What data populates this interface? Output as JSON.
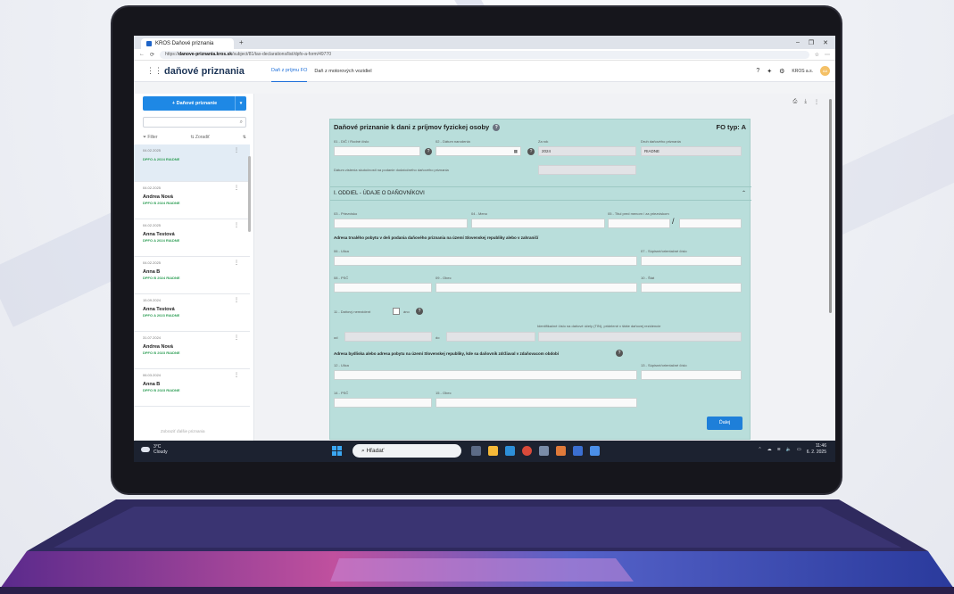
{
  "browser": {
    "tab_title": "KROS Daňové priznania",
    "url_prefix": "https://",
    "url_host": "danove-priznania.kros.sk",
    "url_path": "/subject/81/tax-declarations/list/dpfo-a-form/49770"
  },
  "app": {
    "brand": "daňové priznania",
    "nav_tabs": [
      "Daň z príjmu FO",
      "Daň z motorových vozidiel"
    ],
    "org": "KROS a.s.",
    "avatar": "AA"
  },
  "sidebar": {
    "new_button": "+ Daňové priznanie",
    "filter": "Filter",
    "sort": "Zoradiť",
    "items": [
      {
        "date": "04.02.2025",
        "name": "",
        "status": "DPFO A 2024 RIADNE"
      },
      {
        "date": "04.02.2025",
        "name": "Andrea Nová",
        "status": "DPFO B 2024 RIADNE"
      },
      {
        "date": "04.02.2025",
        "name": "Anna Testová",
        "status": "DPFO A 2024 RIADNE"
      },
      {
        "date": "04.02.2025",
        "name": "Anna B",
        "status": "DPFO B 2024 RIADNE"
      },
      {
        "date": "15.09.2024",
        "name": "Anna Testová",
        "status": "DPFO A 2023 RIADNE"
      },
      {
        "date": "31.07.2024",
        "name": "Andrea Nová",
        "status": "DPFO B 2023 RIADNE"
      },
      {
        "date": "06.03.2024",
        "name": "Anna B",
        "status": "DPFO B 2023 RIADNE"
      }
    ],
    "footer": "Zobraziť ďalšie priznania"
  },
  "form": {
    "title": "Daňové priznanie k dani z príjmov fyzickej osoby",
    "type": "FO typ: A",
    "labels": {
      "dic": "01 - DIČ / Rodné číslo",
      "birth": "02 - Dátum narodenia",
      "year": "Za rok",
      "kind": "Druh daňového priznania",
      "date_note": "Dátum zistenia skutočnosti na podanie dodatočného daňového priznania",
      "surname": "03 - Priezvisko",
      "name": "04 - Meno",
      "titles": "05 - Titul pred menom / za priezviskom",
      "address_head": "Adresa trvalého pobytu v deň podania daňového priznania na území Slovenskej republiky alebo v zahraničí",
      "street": "06 - Ulica",
      "number": "07 - Súpisné/orientačné číslo",
      "zip": "08 - PSČ",
      "city": "09 - Obec",
      "state": "10 - Štát",
      "nonresident": "11 - Daňový nerezident",
      "yes": "áno",
      "tin": "Identifikačné číslo na daňové účely (TIN), pridelené v štáte daňovej rezidencie",
      "from": "od",
      "to": "do",
      "stay_head": "Adresa bydliska alebo adresa pobytu na území Slovenskej republiky, kde sa daňovník zdržiaval v zdaňovacom období",
      "street2": "12 - Ulica",
      "number2": "13 - Súpisné/orientačné číslo",
      "zip2": "14 - PSČ",
      "city2": "15 - Obec"
    },
    "values": {
      "year": "2024",
      "kind": "RIADNE",
      "slash": "/"
    },
    "section": "I. ODDIEL - ÚDAJE O DAŇOVNÍKOVI",
    "next_button": "Ďalej"
  },
  "taskbar": {
    "temp": "3°C",
    "weather": "Cloudy",
    "search": "Hľadať",
    "time": "11:46",
    "date": "6. 2. 2025"
  }
}
